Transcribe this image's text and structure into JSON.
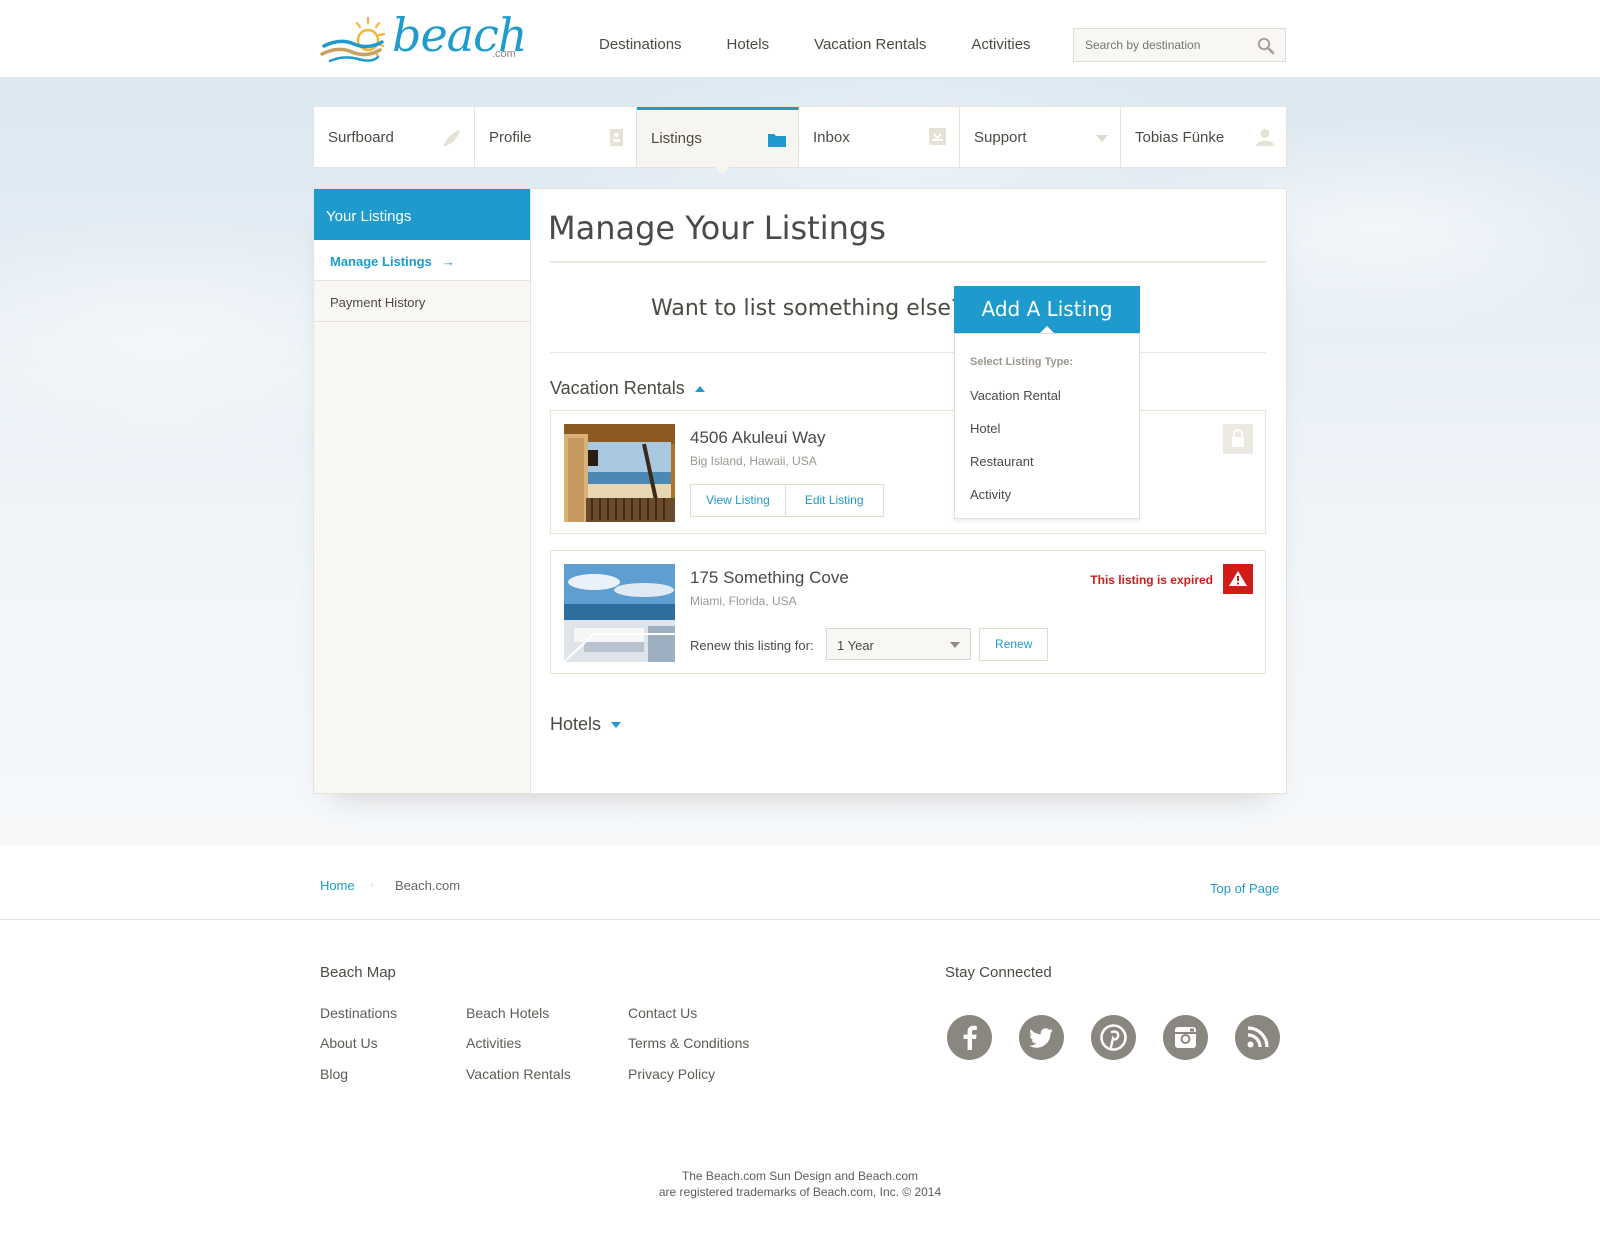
{
  "header": {
    "logo_word": "beach",
    "logo_suffix": ".com",
    "nav": [
      "Destinations",
      "Hotels",
      "Vacation Rentals",
      "Activities"
    ],
    "search_placeholder": "Search by destination"
  },
  "tabs": [
    {
      "label": "Surfboard",
      "icon": "surfboard-icon"
    },
    {
      "label": "Profile",
      "icon": "profile-card-icon"
    },
    {
      "label": "Listings",
      "icon": "folder-icon",
      "active": true
    },
    {
      "label": "Inbox",
      "icon": "inbox-icon"
    },
    {
      "label": "Support",
      "icon": "chevron-down-icon"
    },
    {
      "label": "Tobias Fünke",
      "icon": "user-icon"
    }
  ],
  "sidebar": {
    "heading": "Your Listings",
    "items": [
      {
        "label": "Manage Listings",
        "active": true,
        "arrow": "→"
      },
      {
        "label": "Payment History"
      }
    ]
  },
  "main": {
    "title": "Manage Your Listings",
    "cta_text": "Want to list something else?",
    "add_button": "Add A Listing",
    "dropdown": {
      "heading": "Select Listing Type:",
      "options": [
        "Vacation Rental",
        "Hotel",
        "Restaurant",
        "Activity"
      ]
    },
    "sections": [
      {
        "title": "Vacation Rentals",
        "expanded": true
      },
      {
        "title": "Hotels",
        "expanded": false
      }
    ],
    "listings": [
      {
        "title": "4506 Akuleui Way",
        "location": "Big Island, Hawaii, USA",
        "view_label": "View Listing",
        "edit_label": "Edit Listing",
        "status_icon": "lock-icon"
      },
      {
        "title": "175 Something Cove",
        "location": "Miami, Florida, USA",
        "expired_text": "This listing is expired",
        "renew_label": "Renew this listing for:",
        "renew_value": "1 Year",
        "renew_button": "Renew",
        "status_icon": "warning-icon"
      }
    ]
  },
  "footer": {
    "breadcrumb": {
      "home": "Home",
      "separator": "›",
      "current": "Beach.com"
    },
    "top_link": "Top of Page",
    "beach_map_title": "Beach Map",
    "columns": [
      [
        "Destinations",
        "About Us",
        "Blog"
      ],
      [
        "Beach Hotels",
        "Activities",
        "Vacation Rentals"
      ],
      [
        "Contact Us",
        "Terms & Conditions",
        "Privacy Policy"
      ]
    ],
    "stay_connected_title": "Stay Connected",
    "social": [
      "facebook-icon",
      "twitter-icon",
      "pinterest-icon",
      "instagram-icon",
      "rss-icon"
    ],
    "copyright_line1": "The Beach.com Sun Design and Beach.com",
    "copyright_line2": "are registered trademarks of Beach.com, Inc. © 2014"
  },
  "colors": {
    "accent": "#1e9bcc",
    "danger": "#d21b17",
    "sidebar_bg": "#f8f7f3",
    "social_icon": "#8a8680"
  }
}
